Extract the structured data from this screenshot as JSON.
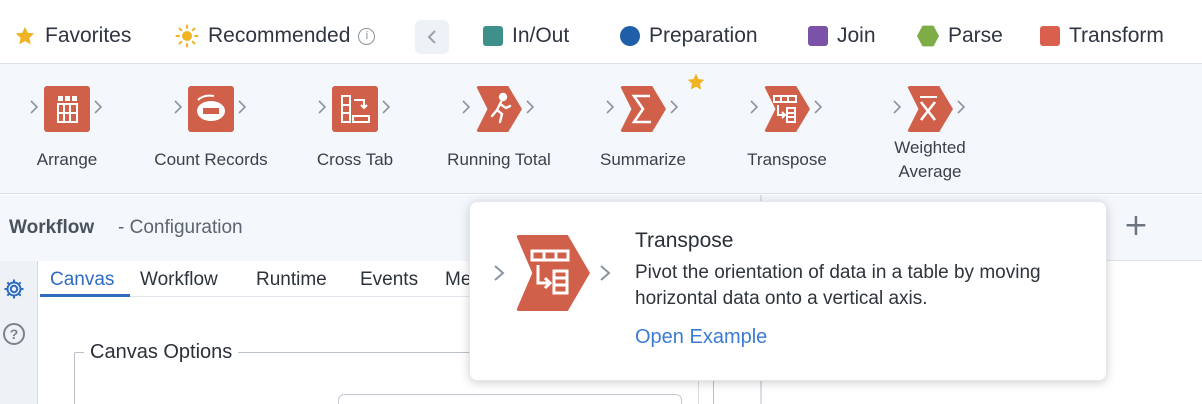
{
  "categories": [
    {
      "label": "Favorites",
      "icon": "star-icon",
      "color": "#f0b323"
    },
    {
      "label": "Recommended",
      "icon": "sun-icon",
      "color": "#f0b323"
    },
    {
      "label": "In/Out",
      "icon": "square-icon",
      "color": "#3f8f8b"
    },
    {
      "label": "Preparation",
      "icon": "circle-icon",
      "color": "#1f5fa8"
    },
    {
      "label": "Join",
      "icon": "square-icon",
      "color": "#7a52a8"
    },
    {
      "label": "Parse",
      "icon": "hexagon-icon",
      "color": "#7eac46"
    },
    {
      "label": "Transform",
      "icon": "square-icon",
      "color": "#d9604c"
    }
  ],
  "tools": [
    {
      "label": "Arrange",
      "icon": "arrange-icon"
    },
    {
      "label": "Count Records",
      "icon": "count-records-icon"
    },
    {
      "label": "Cross Tab",
      "icon": "cross-tab-icon"
    },
    {
      "label": "Running Total",
      "icon": "running-total-icon"
    },
    {
      "label": "Summarize",
      "icon": "summarize-icon",
      "favorite": true
    },
    {
      "label": "Transpose",
      "icon": "transpose-icon"
    },
    {
      "label": "Weighted\nAverage",
      "icon": "weighted-average-icon"
    }
  ],
  "workflow": {
    "title": "Workflow",
    "subtitle": "- Configuration",
    "tabs": [
      "Canvas",
      "Workflow",
      "Runtime",
      "Events",
      "Me"
    ],
    "active_tab": "Canvas",
    "section_title": "Canvas Options"
  },
  "tooltip": {
    "title": "Transpose",
    "description": "Pivot the orientation of data in a table by moving horizontal data onto a vertical axis.",
    "link": "Open Example"
  },
  "colors": {
    "tool_tile": "#d0604a",
    "accent": "#2f6cc0",
    "link": "#3b7bd4"
  }
}
